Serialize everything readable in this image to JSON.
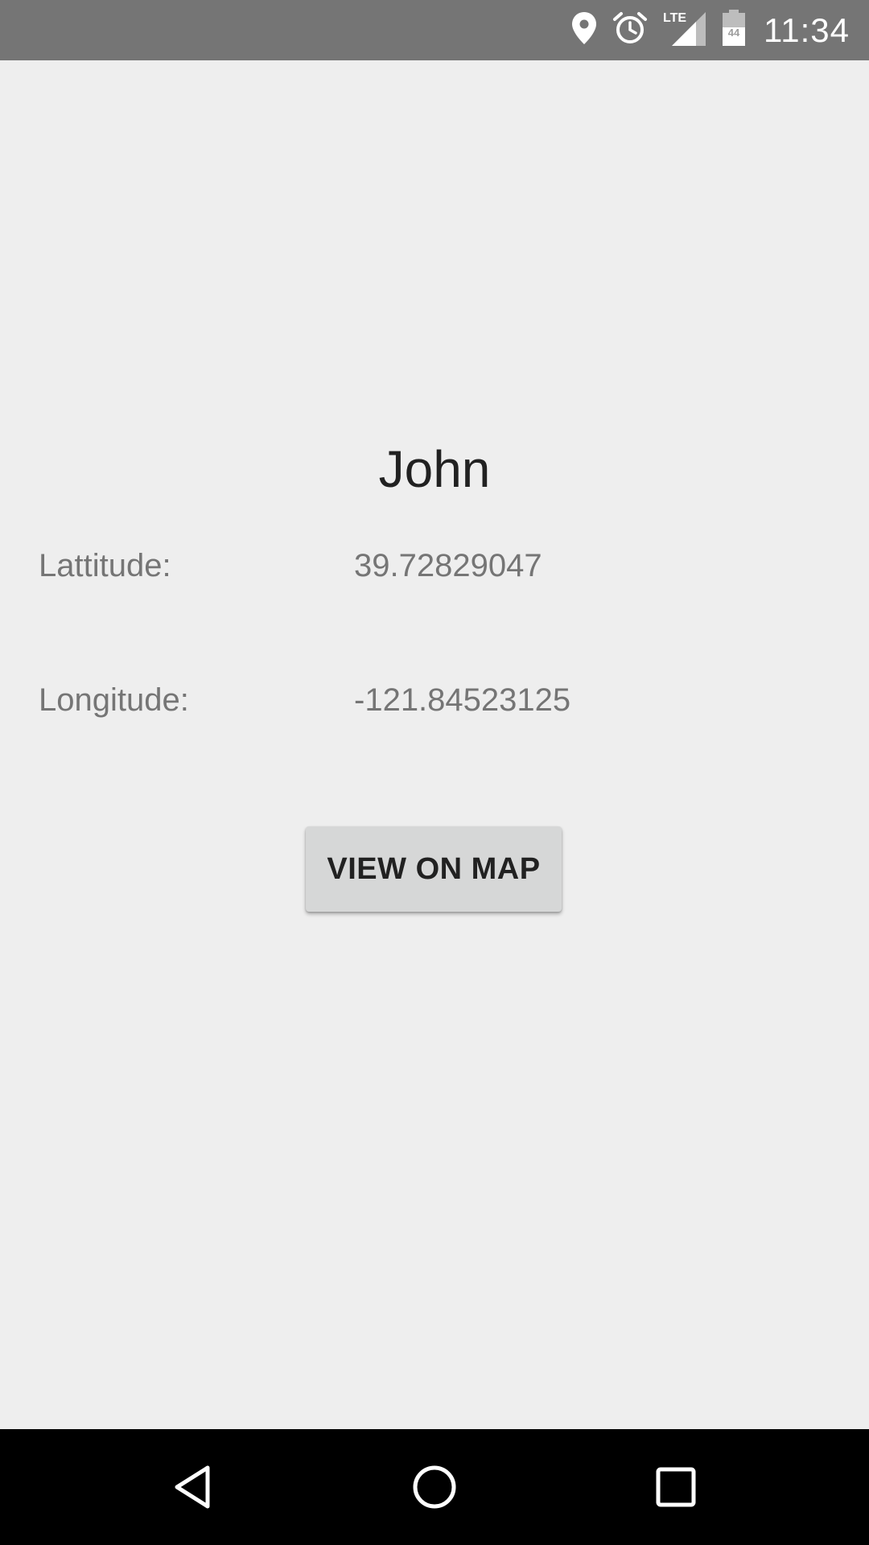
{
  "status_bar": {
    "time": "11:34",
    "icons": [
      "location-icon",
      "alarm-icon",
      "lte-signal-icon",
      "battery-icon"
    ],
    "network_label": "LTE",
    "battery_label": "44"
  },
  "main": {
    "name": "John",
    "latitude_label": "Lattitude:",
    "latitude_value": "39.72829047",
    "longitude_label": "Longitude:",
    "longitude_value": "-121.84523125",
    "view_map_button": "VIEW ON MAP"
  },
  "nav_bar": {
    "icons": [
      "back-icon",
      "home-icon",
      "recents-icon"
    ]
  },
  "colors": {
    "background": "#eeeeee",
    "status_bar": "#757575",
    "nav_bar": "#000000",
    "button": "#d6d7d7",
    "text_primary": "#212121",
    "text_secondary": "#757575"
  }
}
